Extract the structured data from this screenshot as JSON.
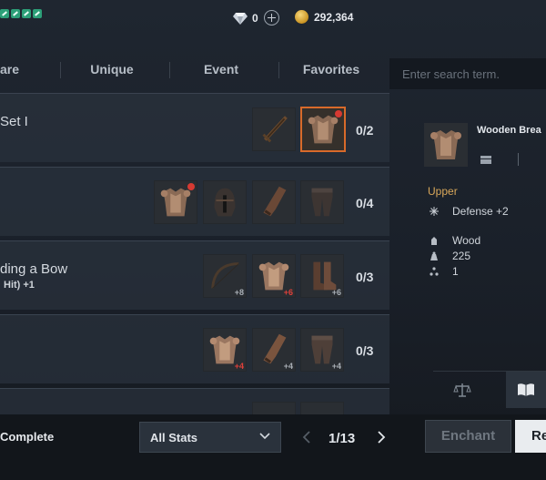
{
  "currency": {
    "gems": "0",
    "gold": "292,364",
    "gem_icon": "diamond-icon",
    "gold_icon": "gold-coin-icon"
  },
  "tabs": [
    {
      "label": "are"
    },
    {
      "label": "Unique"
    },
    {
      "label": "Event"
    },
    {
      "label": "Favorites"
    }
  ],
  "search": {
    "placeholder": "Enter search term."
  },
  "rows": [
    {
      "title": "Set I",
      "subtitle": "",
      "count": "0/2",
      "items": [
        {
          "icon": "sword-icon",
          "enhance": "",
          "dot": false,
          "selected": false
        },
        {
          "icon": "breastplate-icon",
          "enhance": "",
          "dot": true,
          "selected": true
        }
      ]
    },
    {
      "title": "",
      "subtitle": "",
      "count": "0/4",
      "items": [
        {
          "icon": "breastplate-icon",
          "enhance": "",
          "dot": true,
          "selected": false
        },
        {
          "icon": "helmet-icon",
          "enhance": "",
          "dot": false,
          "selected": false
        },
        {
          "icon": "gauntlet-icon",
          "enhance": "",
          "dot": false,
          "selected": false
        },
        {
          "icon": "leggings-icon",
          "enhance": "",
          "dot": false,
          "selected": false
        }
      ]
    },
    {
      "title": "ding a Bow",
      "subtitle": "Hit) +1",
      "count": "0/3",
      "items": [
        {
          "icon": "bow-icon",
          "enhance": "+8",
          "dot": false,
          "selected": false
        },
        {
          "icon": "breastplate-icon",
          "enhance": "+6",
          "dot": false,
          "selected": false,
          "red": true
        },
        {
          "icon": "boots-icon",
          "enhance": "+6",
          "dot": false,
          "selected": false
        }
      ]
    },
    {
      "title": "",
      "subtitle": "",
      "count": "0/3",
      "items": [
        {
          "icon": "breastplate-icon",
          "enhance": "+4",
          "dot": false,
          "selected": false,
          "red": true
        },
        {
          "icon": "gauntlet-icon",
          "enhance": "+4",
          "dot": false,
          "selected": false
        },
        {
          "icon": "leggings-icon",
          "enhance": "+4",
          "dot": false,
          "selected": false
        }
      ]
    }
  ],
  "detail": {
    "name": "Wooden Brea",
    "slot": "Upper",
    "stat": "Defense +2",
    "material": "Wood",
    "weight": "225",
    "quantity": "1"
  },
  "bottom": {
    "complete_label": "Complete",
    "filter": "All Stats",
    "page": "1/13",
    "enchant": "Enchant",
    "second_button": "Re"
  }
}
